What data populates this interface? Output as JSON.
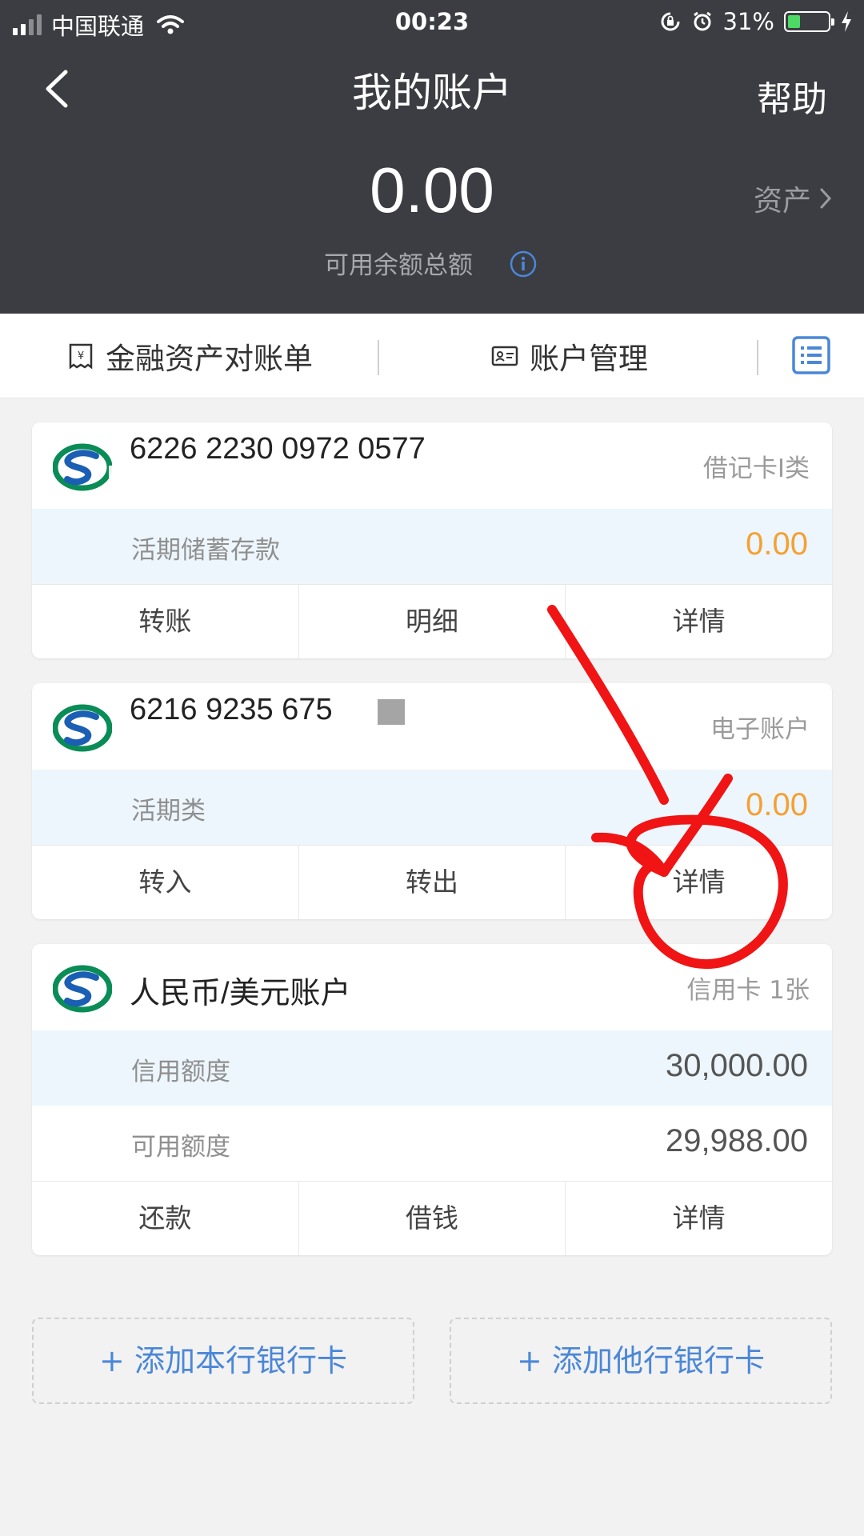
{
  "status_bar": {
    "carrier": "中国联通",
    "time": "00:23",
    "battery_percent": "31%",
    "battery_level": 0.31,
    "icons": [
      "signal-icon",
      "wifi-icon",
      "rotation-lock-icon",
      "alarm-icon",
      "battery-icon",
      "charging-icon"
    ]
  },
  "nav": {
    "title": "我的账户",
    "help_label": "帮助",
    "back_icon": "chevron-left-icon"
  },
  "summary": {
    "balance": "0.00",
    "balance_label": "可用余额总额",
    "assets_label": "资产"
  },
  "tabs": {
    "statement_label": "金融资产对账单",
    "account_label": "账户管理",
    "list_icon": "list-icon"
  },
  "cards": [
    {
      "number": "6226 2230 0972 0577",
      "type": "借记卡Ⅰ类",
      "rows": [
        {
          "label": "活期储蓄存款",
          "value": "0.00"
        }
      ],
      "actions": [
        "转账",
        "明细",
        "详情"
      ]
    },
    {
      "number": "6216 9235 675",
      "type": "电子账户",
      "rows": [
        {
          "label": "活期类",
          "value": "0.00"
        }
      ],
      "actions": [
        "转入",
        "转出",
        "详情"
      ]
    },
    {
      "number": "人民币/美元账户",
      "type": "信用卡 1张",
      "rows": [
        {
          "label": "信用额度",
          "value": "30,000.00"
        },
        {
          "label": "可用额度",
          "value": "29,988.00"
        }
      ],
      "actions": [
        "还款",
        "借钱",
        "详情"
      ]
    }
  ],
  "add_buttons": {
    "own_bank": "+ 添加本行银行卡",
    "other_bank": "+ 添加他行银行卡"
  },
  "colors": {
    "header_bg": "#3b3d42",
    "accent_blue": "#4a87d8",
    "amount_orange": "#f5a033",
    "row_tint": "#edf6fd",
    "annotation_red": "#f01414"
  }
}
